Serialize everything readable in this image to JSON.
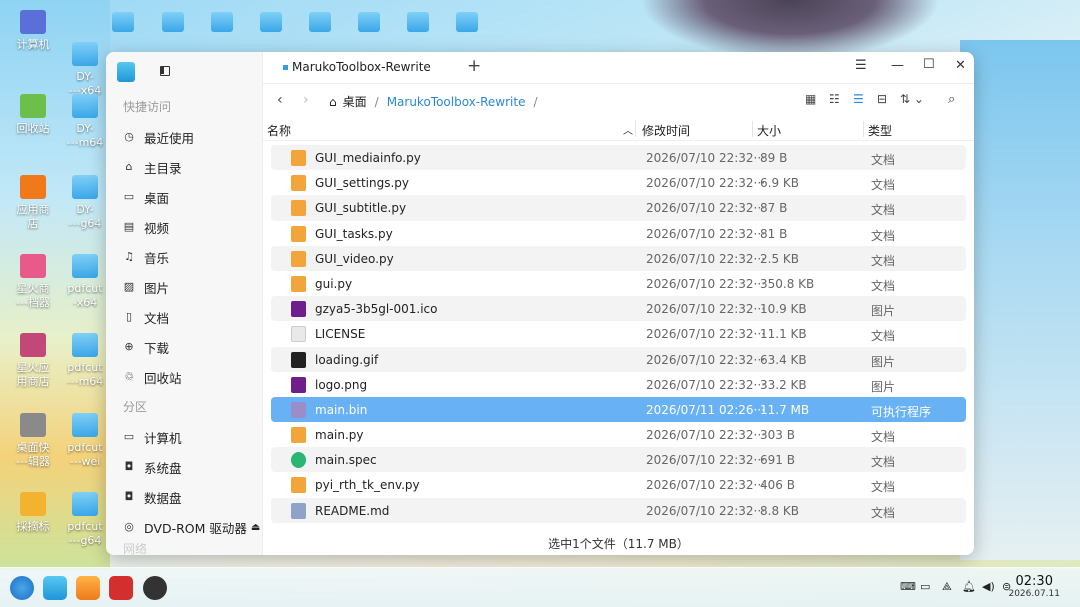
{
  "desktop": {
    "icons": [
      {
        "label": "计算机",
        "name": "computer-desktop-icon"
      },
      {
        "label": "DY-\n---x64",
        "name": "folder-dy-x64-icon"
      },
      {
        "label": "回收站",
        "name": "trash-desktop-icon"
      },
      {
        "label": "DY-\n---m64",
        "name": "folder-dy-m64-icon"
      },
      {
        "label": "应用商\n店",
        "name": "app-store-desktop-icon"
      },
      {
        "label": "DY-\n---g64",
        "name": "folder-dy-g64-icon"
      },
      {
        "label": "星火商\n---档器",
        "name": "spark-store-desktop-icon"
      },
      {
        "label": "pdfcut\n-x64",
        "name": "folder-pdfcut-x64-icon"
      },
      {
        "label": "星火应\n用商店",
        "name": "spark-app-store-icon"
      },
      {
        "label": "pdfcut\n---m64",
        "name": "folder-pdfcut-m64-icon"
      },
      {
        "label": "桌面快\n---辑器",
        "name": "desktop-shortcut-editor-icon"
      },
      {
        "label": "pdfcut\n---wei",
        "name": "folder-pdfcut-wei-icon"
      },
      {
        "label": "採摘标",
        "name": "picker-desktop-icon"
      },
      {
        "label": "pdfcut\n---g64",
        "name": "folder-pdfcut-g64-icon"
      }
    ]
  },
  "window": {
    "tab_title": "MarukoToolbox-Rewrite",
    "breadcrumb": {
      "home": "桌面",
      "current": "MarukoToolbox-Rewrite"
    },
    "sidebar": {
      "quick_access": "快捷访问",
      "quick_items": [
        {
          "label": "最近使用",
          "icon": "clock-icon"
        },
        {
          "label": "主目录",
          "icon": "home-icon"
        },
        {
          "label": "桌面",
          "icon": "desktop-icon"
        },
        {
          "label": "视频",
          "icon": "video-icon"
        },
        {
          "label": "音乐",
          "icon": "music-icon"
        },
        {
          "label": "图片",
          "icon": "picture-icon"
        },
        {
          "label": "文档",
          "icon": "document-icon"
        },
        {
          "label": "下载",
          "icon": "download-icon"
        },
        {
          "label": "回收站",
          "icon": "trash-icon"
        }
      ],
      "partitions": "分区",
      "partition_items": [
        {
          "label": "计算机",
          "icon": "computer-icon"
        },
        {
          "label": "系统盘",
          "icon": "disk-icon"
        },
        {
          "label": "数据盘",
          "icon": "disk-icon"
        },
        {
          "label": "DVD-ROM 驱动器",
          "icon": "dvd-icon"
        }
      ],
      "cutoff": "网络"
    },
    "columns": {
      "name": "名称",
      "modified": "修改时间",
      "size": "大小",
      "type": "类型"
    },
    "files": [
      {
        "name": "GUI_mediainfo.py",
        "date": "2026/07/10 22:32···",
        "size": "89 B",
        "type": "文档",
        "icon": "py"
      },
      {
        "name": "GUI_settings.py",
        "date": "2026/07/10 22:32···",
        "size": "6.9 KB",
        "type": "文档",
        "icon": "py"
      },
      {
        "name": "GUI_subtitle.py",
        "date": "2026/07/10 22:32···",
        "size": "87 B",
        "type": "文档",
        "icon": "py"
      },
      {
        "name": "GUI_tasks.py",
        "date": "2026/07/10 22:32···",
        "size": "81 B",
        "type": "文档",
        "icon": "py"
      },
      {
        "name": "GUI_video.py",
        "date": "2026/07/10 22:32···",
        "size": "2.5 KB",
        "type": "文档",
        "icon": "py"
      },
      {
        "name": "gui.py",
        "date": "2026/07/10 22:32···",
        "size": "350.8 KB",
        "type": "文档",
        "icon": "py"
      },
      {
        "name": "gzya5-3b5gl-001.ico",
        "date": "2026/07/10 22:32···",
        "size": "10.9 KB",
        "type": "图片",
        "icon": "ico"
      },
      {
        "name": "LICENSE",
        "date": "2026/07/10 22:32···",
        "size": "11.1 KB",
        "type": "文档",
        "icon": "lic"
      },
      {
        "name": "loading.gif",
        "date": "2026/07/10 22:32···",
        "size": "63.4 KB",
        "type": "图片",
        "icon": "gif"
      },
      {
        "name": "logo.png",
        "date": "2026/07/10 22:32···",
        "size": "33.2 KB",
        "type": "图片",
        "icon": "ico"
      },
      {
        "name": "main.bin",
        "date": "2026/07/11 02:26···",
        "size": "11.7 MB",
        "type": "可执行程序",
        "icon": "bin",
        "selected": true
      },
      {
        "name": "main.py",
        "date": "2026/07/10 22:32···",
        "size": "303 B",
        "type": "文档",
        "icon": "py"
      },
      {
        "name": "main.spec",
        "date": "2026/07/10 22:32···",
        "size": "691 B",
        "type": "文档",
        "icon": "spec"
      },
      {
        "name": "pyi_rth_tk_env.py",
        "date": "2026/07/10 22:32···",
        "size": "406 B",
        "type": "文档",
        "icon": "py"
      },
      {
        "name": "README.md",
        "date": "2026/07/10 22:32···",
        "size": "8.8 KB",
        "type": "文档",
        "icon": "md"
      }
    ],
    "status": "选中1个文件（11.7 MB）"
  },
  "taskbar": {
    "time": "02:30",
    "date": "2026.07.11"
  },
  "colors": {
    "selection": "#69b1f5",
    "accent": "#2a8ad8"
  }
}
